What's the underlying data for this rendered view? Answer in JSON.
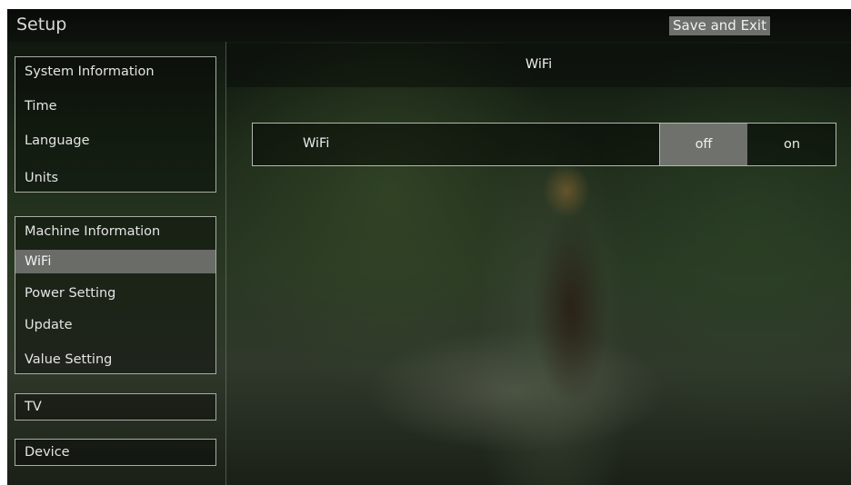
{
  "header": {
    "title": "Setup",
    "save_exit_label": "Save and Exit"
  },
  "sidebar": {
    "groups": [
      {
        "items": [
          {
            "label": "System Information"
          },
          {
            "label": "Time"
          },
          {
            "label": "Language"
          },
          {
            "label": "Units"
          }
        ]
      },
      {
        "items": [
          {
            "label": "Machine Information"
          },
          {
            "label": "WiFi",
            "selected": true
          },
          {
            "label": "Power Setting"
          },
          {
            "label": "Update"
          },
          {
            "label": "Value Setting"
          }
        ]
      },
      {
        "items": [
          {
            "label": "TV"
          }
        ]
      },
      {
        "items": [
          {
            "label": "Device"
          }
        ]
      }
    ]
  },
  "content": {
    "title": "WiFi",
    "setting": {
      "label": "WiFi",
      "options": [
        "off",
        "on"
      ],
      "selected": "off"
    }
  },
  "colors": {
    "selected_bg": "#6a6c68",
    "border": "#a9aca4",
    "topbar_bg": "#0a0c0a"
  }
}
